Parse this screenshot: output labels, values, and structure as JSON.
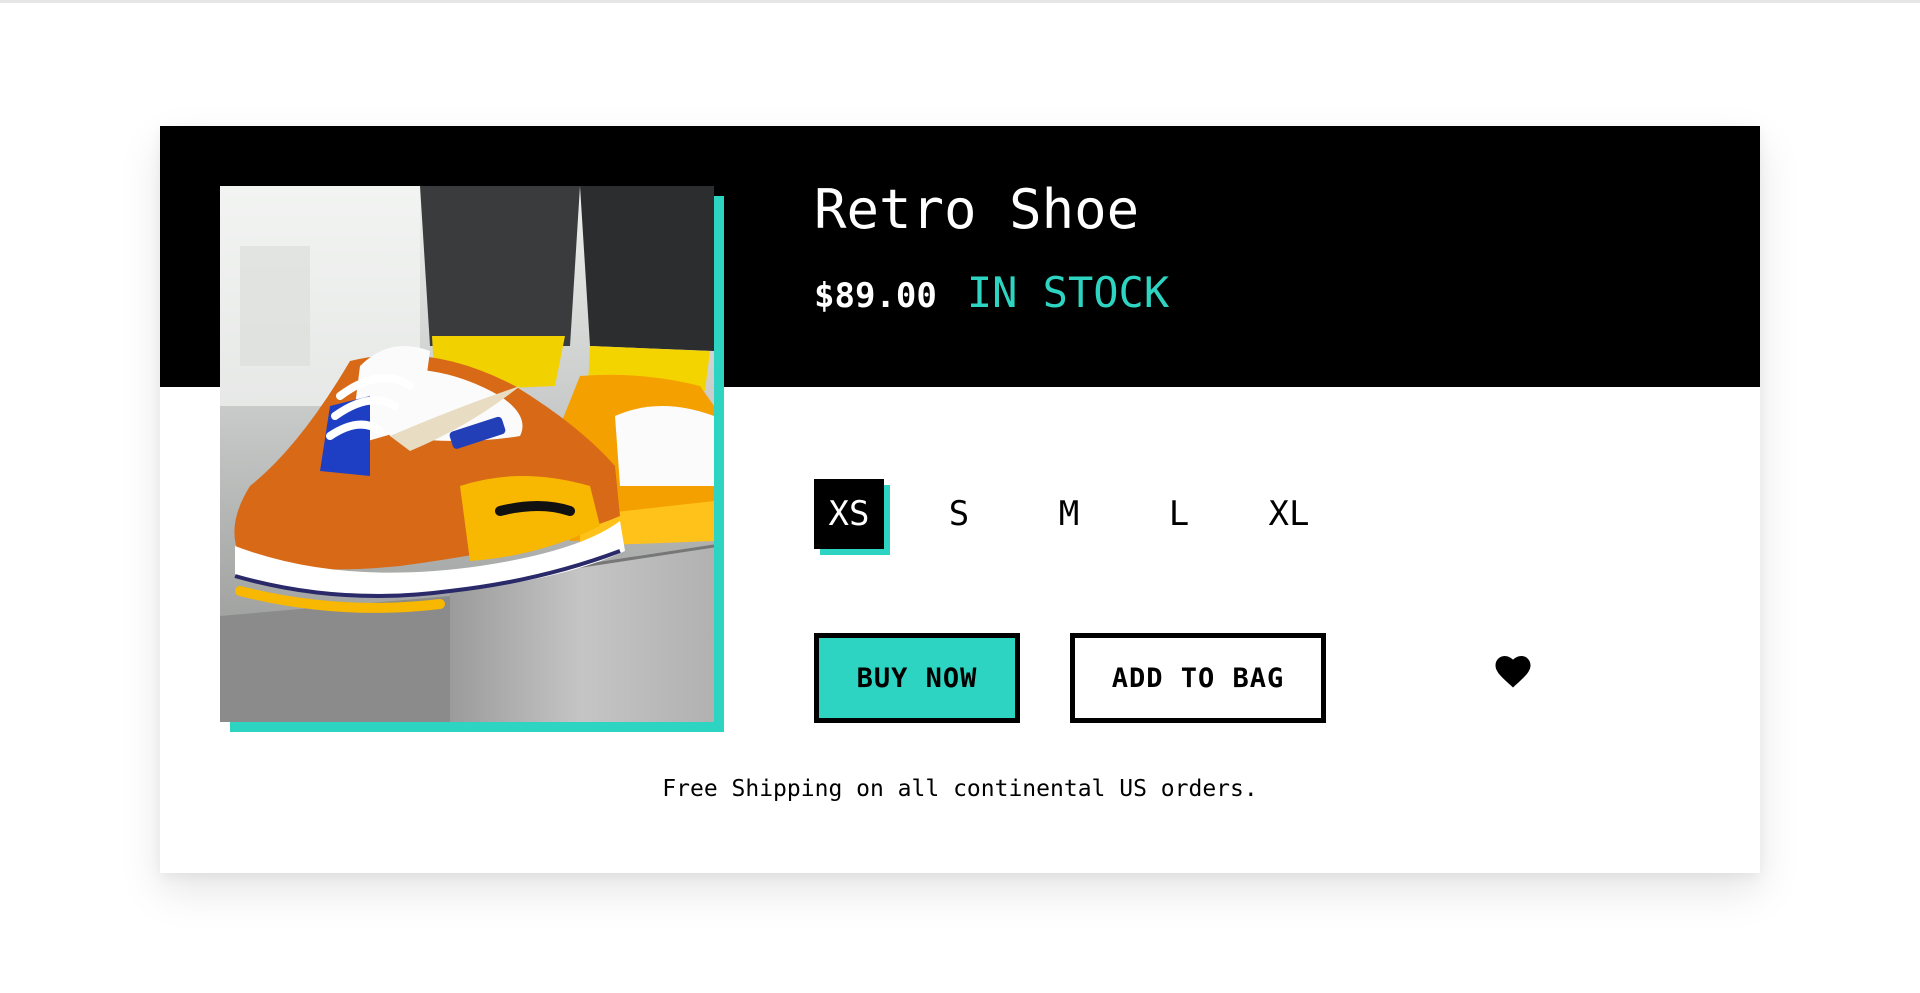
{
  "product": {
    "title": "Retro Shoe",
    "price": "$89.00",
    "stock_status": "IN STOCK",
    "image_alt": "Retro Shoe"
  },
  "sizes": {
    "options": [
      "XS",
      "S",
      "M",
      "L",
      "XL"
    ],
    "selected": "XS"
  },
  "actions": {
    "buy_label": "BUY NOW",
    "bag_label": "ADD TO BAG",
    "wishlist_icon": "heart-icon"
  },
  "footer": {
    "shipping_note": "Free Shipping on all continental US orders."
  },
  "colors": {
    "accent": "#2dd4c1",
    "header_bg": "#000000",
    "text": "#000000",
    "background": "#ffffff"
  }
}
